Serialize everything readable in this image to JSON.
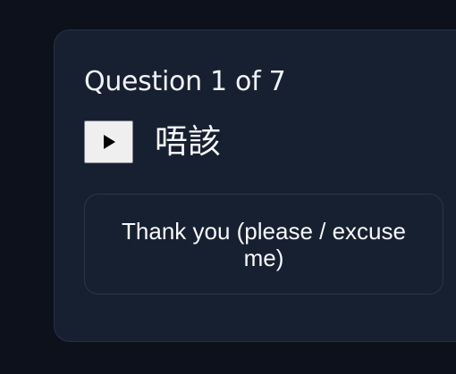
{
  "quiz": {
    "counter": "Question 1 of 7",
    "term": "唔該",
    "play_icon": "play-icon",
    "options": [
      {
        "label": "Thank you (please / excuse me)"
      }
    ]
  },
  "colors": {
    "background": "#0c111b",
    "card": "#172030",
    "text": "#f7f8fb",
    "border": "#263247"
  }
}
